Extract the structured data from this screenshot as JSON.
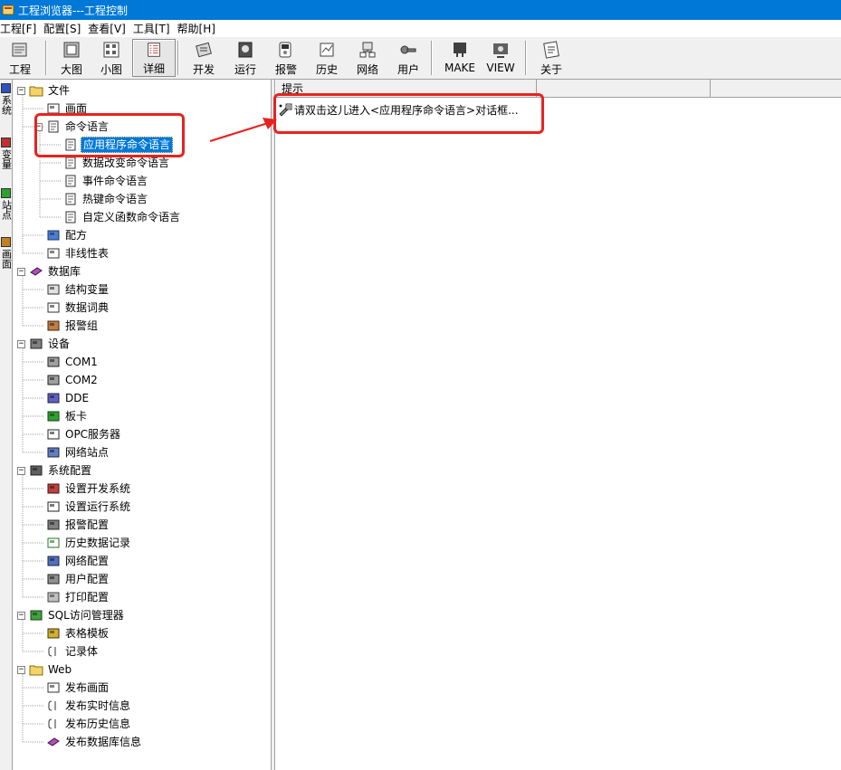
{
  "window": {
    "title": "工程浏览器---工程控制"
  },
  "menu": [
    "工程[F]",
    "配置[S]",
    "查看[V]",
    "工具[T]",
    "帮助[H]"
  ],
  "toolbar": {
    "buttons": [
      {
        "label": "工程",
        "icon": "project-icon"
      },
      {
        "label": "大图",
        "icon": "large-icons-icon"
      },
      {
        "label": "小图",
        "icon": "small-icons-icon"
      },
      {
        "label": "详细",
        "icon": "details-icon",
        "pressed": true
      },
      {
        "label": "开发",
        "icon": "develop-icon"
      },
      {
        "label": "运行",
        "icon": "run-icon"
      },
      {
        "label": "报警",
        "icon": "alarm-icon"
      },
      {
        "label": "历史",
        "icon": "history-icon"
      },
      {
        "label": "网络",
        "icon": "network-icon"
      },
      {
        "label": "用户",
        "icon": "user-icon"
      },
      {
        "label": "MAKE",
        "icon": "make-icon"
      },
      {
        "label": "VIEW",
        "icon": "view-icon"
      },
      {
        "label": "关于",
        "icon": "about-icon"
      }
    ]
  },
  "side_tabs": [
    "系统",
    "变量",
    "站点",
    "画面"
  ],
  "tree": [
    {
      "label": "文件",
      "icon": "folder-icon",
      "expanded": true
    },
    {
      "label": "画面",
      "icon": "screen-icon"
    },
    {
      "label": "命令语言",
      "icon": "script-icon",
      "expanded": true
    },
    {
      "label": "应用程序命令语言",
      "icon": "script-doc-icon",
      "selected": true
    },
    {
      "label": "数据改变命令语言",
      "icon": "script-doc-icon"
    },
    {
      "label": "事件命令语言",
      "icon": "script-doc-icon"
    },
    {
      "label": "热键命令语言",
      "icon": "script-doc-icon"
    },
    {
      "label": "自定义函数命令语言",
      "icon": "script-doc-icon"
    },
    {
      "label": "配方",
      "icon": "recipe-icon"
    },
    {
      "label": "非线性表",
      "icon": "nonlinear-table-icon"
    },
    {
      "label": "数据库",
      "icon": "database-icon",
      "expanded": true
    },
    {
      "label": "结构变量",
      "icon": "struct-variable-icon"
    },
    {
      "label": "数据词典",
      "icon": "data-dictionary-icon"
    },
    {
      "label": "报警组",
      "icon": "alarm-group-icon"
    },
    {
      "label": "设备",
      "icon": "device-icon",
      "expanded": true
    },
    {
      "label": "COM1",
      "icon": "com-port-icon"
    },
    {
      "label": "COM2",
      "icon": "com-port-icon"
    },
    {
      "label": "DDE",
      "icon": "dde-icon"
    },
    {
      "label": "板卡",
      "icon": "board-card-icon"
    },
    {
      "label": "OPC服务器",
      "icon": "opc-server-icon"
    },
    {
      "label": "网络站点",
      "icon": "network-station-icon"
    },
    {
      "label": "系统配置",
      "icon": "system-config-icon",
      "expanded": true
    },
    {
      "label": "设置开发系统",
      "icon": "dev-system-icon"
    },
    {
      "label": "设置运行系统",
      "icon": "run-system-icon"
    },
    {
      "label": "报警配置",
      "icon": "alarm-config-icon"
    },
    {
      "label": "历史数据记录",
      "icon": "history-record-icon"
    },
    {
      "label": "网络配置",
      "icon": "network-config-icon"
    },
    {
      "label": "用户配置",
      "icon": "user-config-icon"
    },
    {
      "label": "打印配置",
      "icon": "print-config-icon"
    },
    {
      "label": "SQL访问管理器",
      "icon": "sql-manager-icon",
      "expanded": true
    },
    {
      "label": "表格模板",
      "icon": "table-template-icon"
    },
    {
      "label": "记录体",
      "icon": "record-body-icon"
    },
    {
      "label": "Web",
      "icon": "folder-icon",
      "expanded": true
    },
    {
      "label": "发布画面",
      "icon": "screen-icon"
    },
    {
      "label": "发布实时信息",
      "icon": "record-body-icon"
    },
    {
      "label": "发布历史信息",
      "icon": "record-body-icon"
    },
    {
      "label": "发布数据库信息",
      "icon": "database-icon"
    }
  ],
  "list": {
    "columns": [
      "提示",
      "",
      ""
    ],
    "rows": [
      {
        "text": "请双击这儿进入<应用程序命令语言>对话框...",
        "icon": "wizard-icon"
      }
    ]
  },
  "colors": {
    "titlebar": "#0078d7",
    "selection": "#0078d7",
    "annotation": "#e8231f"
  }
}
